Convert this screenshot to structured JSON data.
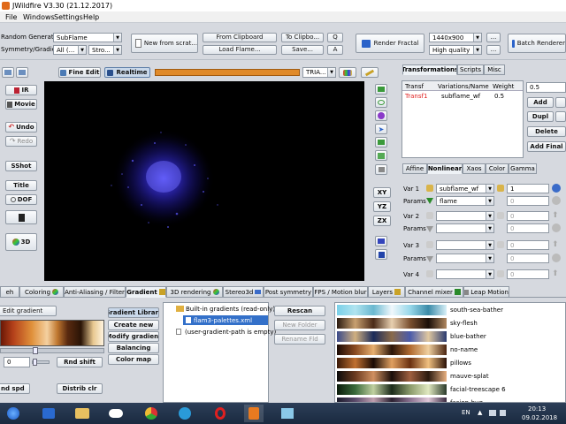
{
  "window": {
    "title": "JWildfire V3.30 (21.12.2017)"
  },
  "menu": [
    "File",
    "Windows",
    "Settings",
    "Help"
  ],
  "toolbar": {
    "random_generator_label": "Random Generator",
    "random_generator_value": "SubFlame",
    "symmetry_label": "Symmetry/Gradient",
    "symmetry_value": "All (...",
    "stroke_value": "Stro...",
    "new_from_scratch": "New from scrat...",
    "from_clipboard": "From Clipboard",
    "to_clipboard": "To Clipbo...",
    "load_flame": "Load Flame...",
    "save": "Save...",
    "btn_q": "Q",
    "btn_a": "A",
    "render_fractal": "Render Fractal",
    "resolution_value": "1440x900",
    "quality_value": "High quality",
    "more": "...",
    "batch_renderer": "Batch Renderer"
  },
  "preview_bar": {
    "fine_edit": "Fine Edit",
    "realtime": "Realtime",
    "tria": "TRIA..."
  },
  "left_tools": {
    "ir": "IR",
    "movie": "Movie",
    "undo": "Undo",
    "redo": "Redo",
    "sshot": "SShot",
    "title": "Title",
    "dof": "DOF",
    "three_d": "3D"
  },
  "side_tools": {
    "xy": "XY",
    "yz": "YZ",
    "zx": "ZX"
  },
  "transforms_panel": {
    "tabs": [
      "Transformations",
      "Scripts",
      "Misc"
    ],
    "columns": [
      "Transf",
      "Variations/Name",
      "Weight"
    ],
    "row": {
      "transf": "Transf1",
      "name": "subflame_wf",
      "weight": "0.5"
    },
    "value_input": "0.5",
    "buttons": {
      "add": "Add",
      "dupl": "Dupl",
      "delete": "Delete",
      "add_final": "Add Final"
    }
  },
  "nonlinear_panel": {
    "tabs": [
      "Affine",
      "Nonlinear",
      "Xaos",
      "Color",
      "Gamma"
    ],
    "rows": [
      {
        "label": "Var 1",
        "value": "subflame_wf",
        "amount": "1"
      },
      {
        "label": "Params",
        "value": "flame",
        "amount": "0"
      },
      {
        "label": "Var 2",
        "value": "",
        "amount": "0"
      },
      {
        "label": "Params",
        "value": "",
        "amount": "0"
      },
      {
        "label": "Var 3",
        "value": "",
        "amount": "0"
      },
      {
        "label": "Params",
        "value": "",
        "amount": "0"
      },
      {
        "label": "Var 4",
        "value": "",
        "amount": "0"
      }
    ]
  },
  "bottom_tabs": [
    "eh",
    "Coloring",
    "Anti-Aliasing / Filter",
    "Gradient",
    "3D rendering",
    "Stereo3d",
    "Post symmetry",
    "FPS / Motion blur",
    "Layers",
    "Channel mixer",
    "Leap Motion"
  ],
  "gradient_panel": {
    "edit_gradient": "Edit gradient",
    "shift_value": "0",
    "rnd_shift": "Rnd shift",
    "rnd_spd": "nd spd",
    "distrib_clr": "Distrib clr",
    "side_buttons": [
      "Gradient Library",
      "Create new",
      "Modify gradient",
      "Balancing",
      "Color map"
    ],
    "tree": {
      "root": "Built-in gradients (read-only)",
      "selected": "flam3-palettes.xml",
      "user": "(user-gradient-path is empty)"
    },
    "tree_buttons": [
      "Rescan",
      "New Folder",
      "Rename Fld"
    ],
    "palettes": [
      "south-sea-bather",
      "sky-flesh",
      "blue-bather",
      "no-name",
      "pillows",
      "mauve-splat",
      "facial-treescape 6",
      "fasion-bug"
    ]
  },
  "taskbar": {
    "lang": "EN",
    "time": "20:13",
    "date": "09.02.2018"
  }
}
